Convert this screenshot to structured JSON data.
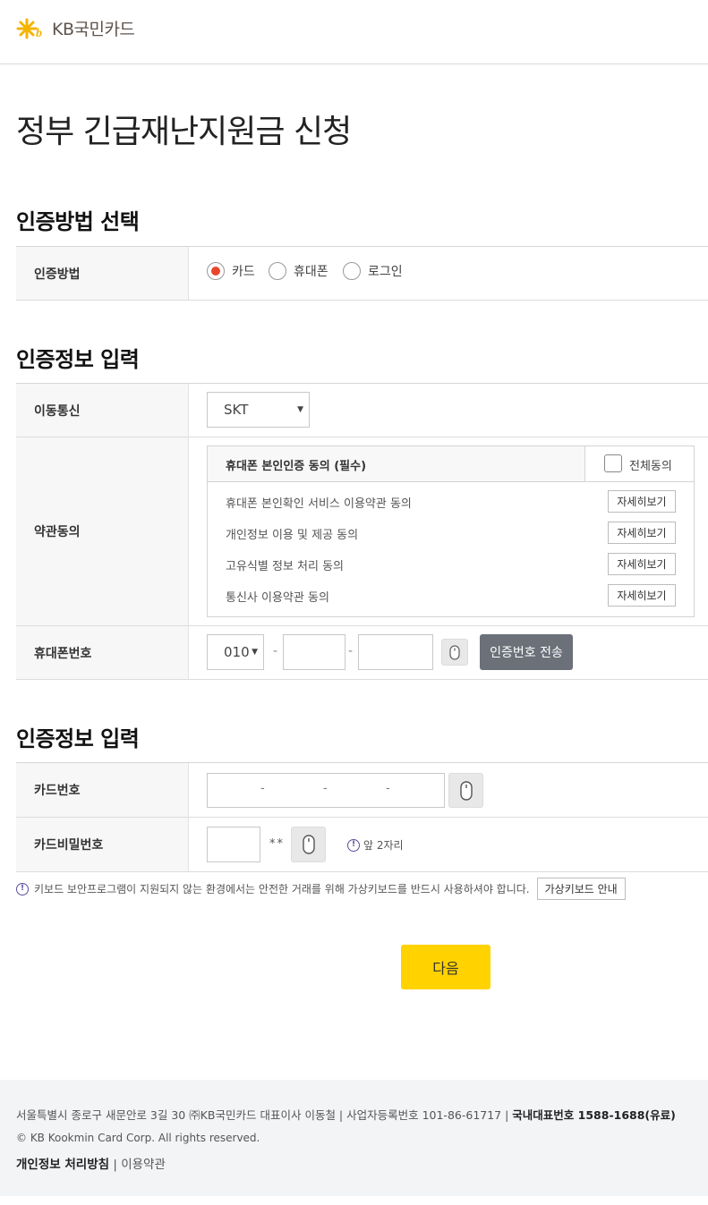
{
  "header": {
    "logo_text": "KB국민카드"
  },
  "page_title": "정부 긴급재난지원금 신청",
  "auth_method_section": {
    "title": "인증방법 선택",
    "label": "인증방법",
    "options": [
      "카드",
      "휴대폰",
      "로그인"
    ],
    "selected": "카드"
  },
  "phone_auth_section": {
    "title": "인증정보 입력",
    "carrier": {
      "label": "이동통신",
      "value": "SKT"
    },
    "terms": {
      "label": "약관동의",
      "box_title": "휴대폰 본인인증 동의 (필수)",
      "agree_all": "전체동의",
      "items": [
        "휴대폰 본인확인 서비스 이용약관 동의",
        "개인정보 이용 및 제공 동의",
        "고유식별 정보 처리 동의",
        "통신사 이용약관 동의"
      ],
      "detail_label": "자세히보기"
    },
    "phone": {
      "label": "휴대폰번호",
      "prefix": "010",
      "dash": "-",
      "send_label": "인증번호 전송"
    }
  },
  "card_auth_section": {
    "title": "인증정보 입력",
    "card_number": {
      "label": "카드번호",
      "dash": "-"
    },
    "card_password": {
      "label": "카드비밀번호",
      "mask": "**",
      "hint": "앞 2자리"
    }
  },
  "notice": {
    "text": "키보드 보안프로그램이 지원되지 않는 환경에서는 안전한 거래를 위해 가상키보드를 반드시 사용하셔야 합니다.",
    "button": "가상키보드 안내"
  },
  "next_button": "다음",
  "footer": {
    "address": "서울특별시 종로구 새문안로 3길 30 ㈜KB국민카드 대표이사 이동철 | 사업자등록번호 101-86-61717 | ",
    "hotline": "국내대표번호 1588-1688(유료)",
    "copyright": "© KB Kookmin Card Corp. All rights reserved.",
    "privacy": "개인정보 처리방침",
    "separator": " | ",
    "terms": "이용약관"
  },
  "colors": {
    "brand_yellow": "#ffd200",
    "radio_red": "#e8462c",
    "send_gray": "#6b7079",
    "info_purple": "#5a4fa0"
  },
  "icons": [
    "kb-star-logo",
    "mouse-icon",
    "info-icon",
    "dropdown-arrow-icon"
  ]
}
